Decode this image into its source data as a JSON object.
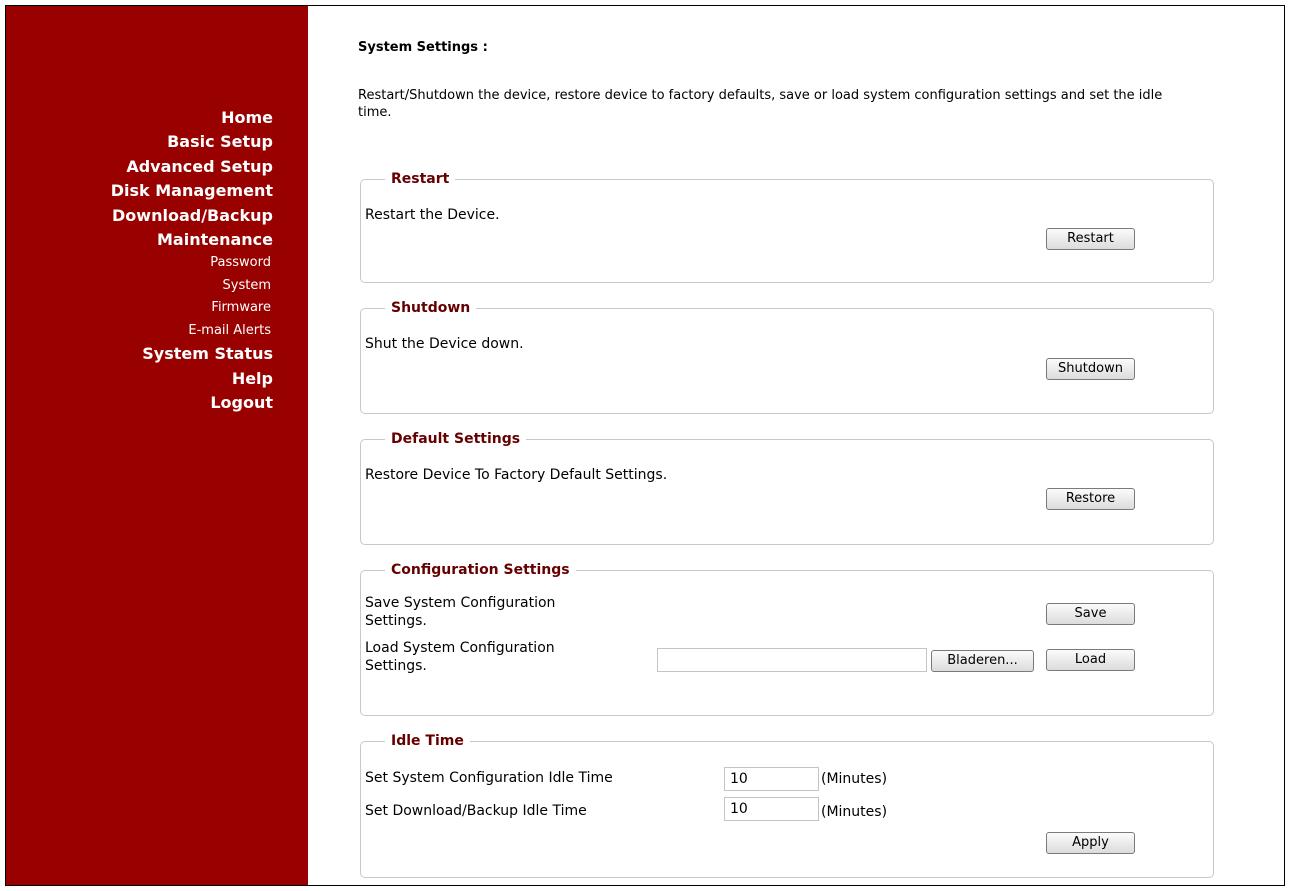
{
  "nav": {
    "items": [
      {
        "label": "Home",
        "type": "main"
      },
      {
        "label": "Basic Setup",
        "type": "main"
      },
      {
        "label": "Advanced Setup",
        "type": "main"
      },
      {
        "label": "Disk Management",
        "type": "main"
      },
      {
        "label": "Download/Backup",
        "type": "main"
      },
      {
        "label": "Maintenance",
        "type": "main"
      },
      {
        "label": "Password",
        "type": "sub"
      },
      {
        "label": "System",
        "type": "sub"
      },
      {
        "label": "Firmware",
        "type": "sub"
      },
      {
        "label": "E-mail Alerts",
        "type": "sub"
      },
      {
        "label": "System Status",
        "type": "main"
      },
      {
        "label": "Help",
        "type": "main"
      },
      {
        "label": "Logout",
        "type": "main"
      }
    ]
  },
  "page": {
    "title": "System Settings :",
    "description": "Restart/Shutdown the device, restore device to factory defaults, save or load system configuration settings and set the idle time."
  },
  "sections": {
    "restart": {
      "legend": "Restart",
      "text": "Restart the Device.",
      "button": "Restart"
    },
    "shutdown": {
      "legend": "Shutdown",
      "text": "Shut the Device down.",
      "button": "Shutdown"
    },
    "defaults": {
      "legend": "Default Settings",
      "text": "Restore Device To Factory Default Settings.",
      "button": "Restore"
    },
    "config": {
      "legend": "Configuration Settings",
      "save_text": "Save System Configuration Settings.",
      "save_button": "Save",
      "load_text": "Load System Configuration Settings.",
      "file_value": "",
      "browse_button": "Bladeren...",
      "load_button": "Load"
    },
    "idle": {
      "legend": "Idle Time",
      "config_label": "Set System Configuration Idle Time",
      "config_value": "10",
      "backup_label": "Set Download/Backup Idle Time",
      "backup_value": "10",
      "unit": "(Minutes)",
      "apply_button": "Apply"
    }
  },
  "colors": {
    "sidebar": "#990000",
    "legend": "#660000"
  }
}
